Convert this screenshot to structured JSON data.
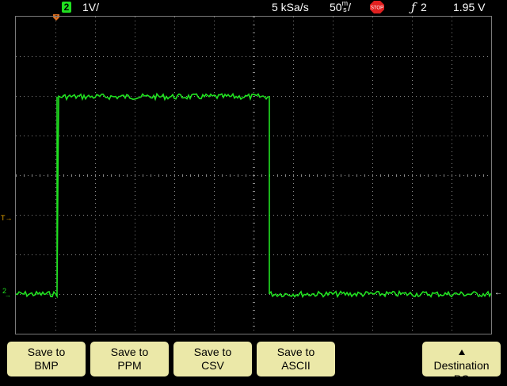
{
  "status": {
    "channel_badge": "2",
    "volts_per_div": "1V/",
    "sample_rate": "5 kSa/s",
    "time_per_div_value": "50",
    "time_per_div_unit_top": "m",
    "time_per_div_unit_bottom": "s",
    "time_per_div_suffix": "/",
    "run_state_icon": "stop-icon",
    "trigger_source": "2",
    "trigger_level": "1.95  V"
  },
  "markers": {
    "trigger_time_marker": "T",
    "channel_marker": "2",
    "trigger_level_arrow": "←"
  },
  "colors": {
    "trace": "#20e020",
    "softkey_bg": "#ebe8a8",
    "grid": "#8a8a8a"
  },
  "softkeys": [
    {
      "line1": "Save to",
      "line2": "BMP"
    },
    {
      "line1": "Save to",
      "line2": "PPM"
    },
    {
      "line1": "Save to",
      "line2": "CSV"
    },
    {
      "line1": "Save to",
      "line2": "ASCII"
    },
    {
      "line1": "Destination",
      "line2": "PC",
      "icon": "triangle-up-icon"
    }
  ]
}
